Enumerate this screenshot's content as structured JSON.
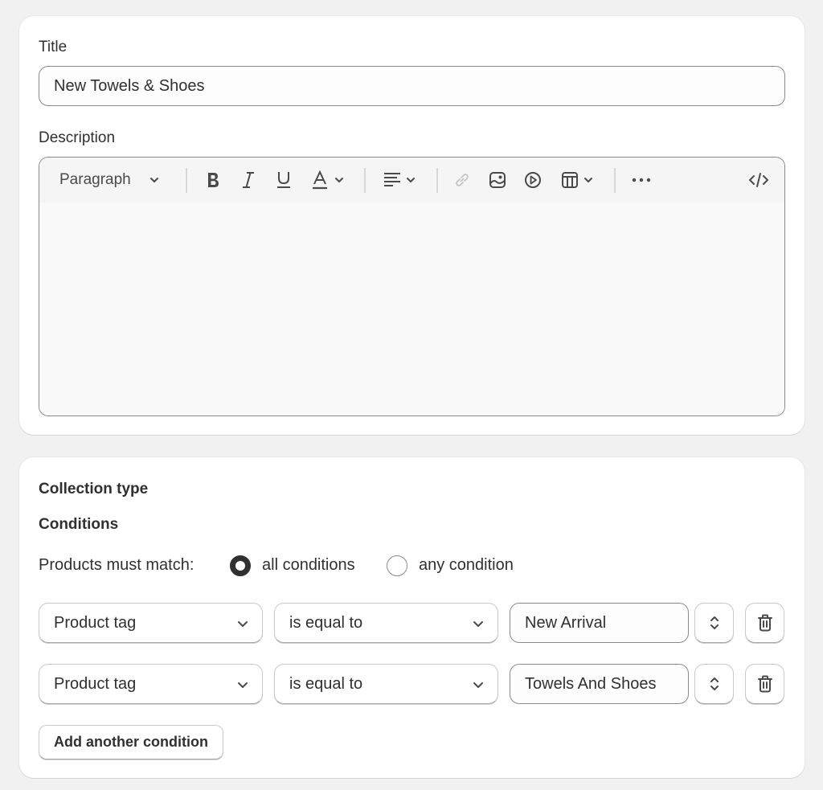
{
  "details": {
    "title_label": "Title",
    "title_value": "New Towels & Shoes",
    "description_label": "Description",
    "toolbar": {
      "paragraph_label": "Paragraph",
      "buttons": [
        "bold",
        "italic",
        "underline",
        "text-color",
        "align",
        "link",
        "image",
        "video",
        "table",
        "more",
        "show-html"
      ]
    },
    "description_value": ""
  },
  "collection": {
    "type_heading": "Collection type",
    "conditions_heading": "Conditions",
    "match_label": "Products must match:",
    "match_options": [
      {
        "label": "all conditions",
        "selected": true
      },
      {
        "label": "any condition",
        "selected": false
      }
    ],
    "rows": [
      {
        "field": "Product tag",
        "operator": "is equal to",
        "value": "New Arrival"
      },
      {
        "field": "Product tag",
        "operator": "is equal to",
        "value": "Towels And Shoes"
      }
    ],
    "add_condition_label": "Add another condition"
  }
}
